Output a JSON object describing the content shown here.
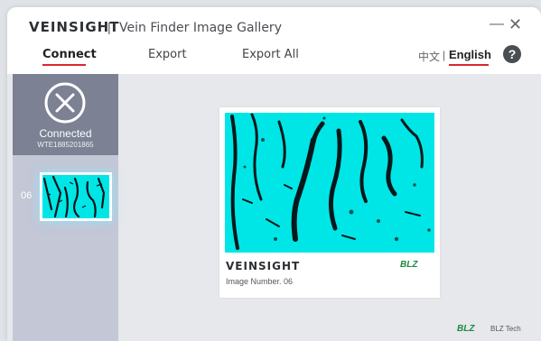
{
  "header": {
    "logo": "VEINSIGHT",
    "separator": "|",
    "title": "Vein Finder Image Gallery",
    "minimize": "—",
    "close": "✕",
    "tabs": [
      {
        "label": "Connect",
        "active": true
      },
      {
        "label": "Export",
        "active": false
      },
      {
        "label": "Export All",
        "active": false
      }
    ],
    "lang_cn": "中文",
    "lang_sep": "|",
    "lang_en": "English",
    "help": "?"
  },
  "sidebar": {
    "device": {
      "status": "Connected",
      "serial": "WTE1885201865",
      "icon": "circle-x-icon"
    },
    "thumbs": [
      {
        "number": "06"
      }
    ]
  },
  "card": {
    "logo": "VEINSIGHT",
    "caption": "Image Number. 06",
    "brand": "BLZ"
  },
  "footer": {
    "brand": "BLZ",
    "tech": "BLZ Tech"
  },
  "colors": {
    "accent": "#d9272e",
    "image": "#00e6e6",
    "sidebar": "#c3c7d6",
    "device_bg": "#7c8294"
  }
}
